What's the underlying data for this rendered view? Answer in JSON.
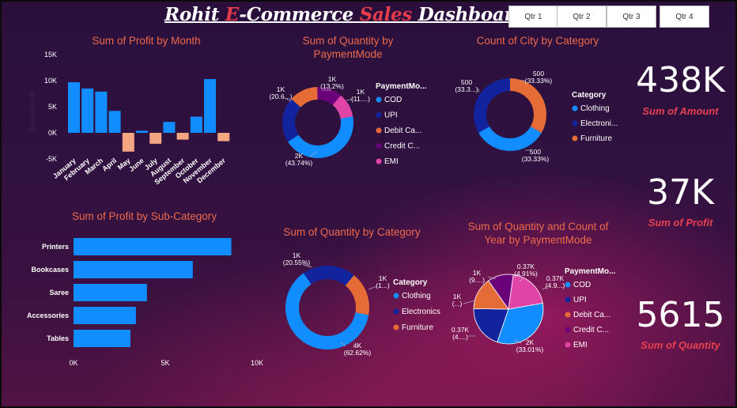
{
  "header": {
    "title_part1": "Rohit ",
    "title_part2": "E",
    "title_part3": "-Commerce ",
    "title_part4": "Sales",
    "title_part5": " Dashboard"
  },
  "slicer": [
    "Qtr 1",
    "Qtr 2",
    "Qtr 3",
    "Qtr 4"
  ],
  "colors": {
    "cod": "#118dff",
    "upi": "#12239e",
    "debit": "#e66c37",
    "credit": "#6b007b",
    "emi": "#e044a7",
    "profit_pos": "#118dff",
    "profit_neg": "#f4a582",
    "title": "#ee6a4a",
    "kpi_label": "#e84050"
  },
  "kpis": [
    {
      "value": "438K",
      "label": "Sum of Amount"
    },
    {
      "value": "37K",
      "label": "Sum of Profit"
    },
    {
      "value": "5615",
      "label": "Sum of Quantity"
    }
  ],
  "chart_data": [
    {
      "id": "profit_month",
      "type": "bar",
      "title": "Sum of Profit by Month",
      "ylabel": "Sum of Profit",
      "xlabel": "",
      "ylim": [
        -5000,
        15000
      ],
      "yticks": [
        "15K",
        "10K",
        "5K",
        "0K",
        "-5K"
      ],
      "categories": [
        "January",
        "February",
        "March",
        "April",
        "May",
        "June",
        "July",
        "August",
        "September",
        "October",
        "November",
        "December"
      ],
      "values": [
        9700,
        8500,
        7900,
        4200,
        -3600,
        400,
        -2100,
        2100,
        -1300,
        3100,
        10300,
        -1600
      ]
    },
    {
      "id": "qty_payment",
      "type": "pie",
      "donut": true,
      "title": "Sum of Quantity by PaymentMode",
      "legend_title": "PaymentMo...",
      "legend": [
        "COD",
        "UPI",
        "Debit Ca...",
        "Credit C...",
        "EMI"
      ],
      "series": [
        {
          "name": "COD",
          "value": 43.74,
          "label": "2K",
          "sublabel": "(43.74%)"
        },
        {
          "name": "UPI",
          "value": 20.6,
          "label": "1K",
          "sublabel": "(20.6...)"
        },
        {
          "name": "Debit Card",
          "value": 13.2,
          "label": "1K",
          "sublabel": "(13.2%)"
        },
        {
          "name": "Credit Card",
          "value": 11.4,
          "label": "1K",
          "sublabel": "(11....)"
        },
        {
          "name": "EMI",
          "value": 11.06,
          "label": "",
          "sublabel": ""
        }
      ]
    },
    {
      "id": "city_category",
      "type": "pie",
      "donut": true,
      "title": "Count of City by Category",
      "legend_title": "Category",
      "legend": [
        "Clothing",
        "Electroni...",
        "Furniture"
      ],
      "series": [
        {
          "name": "Clothing",
          "value": 33.33,
          "label": "500",
          "sublabel": "(33.33%)"
        },
        {
          "name": "Electronics",
          "value": 33.33,
          "label": "500",
          "sublabel": "(33.3...)"
        },
        {
          "name": "Furniture",
          "value": 33.33,
          "label": "500",
          "sublabel": "(33.33%)"
        }
      ]
    },
    {
      "id": "profit_subcat",
      "type": "bar",
      "orientation": "horizontal",
      "title": "Sum of Profit by Sub-Category",
      "xlim": [
        0,
        10000
      ],
      "xticks": [
        "0K",
        "5K",
        "10K"
      ],
      "categories": [
        "Printers",
        "Bookcases",
        "Saree",
        "Accessories",
        "Tables"
      ],
      "values": [
        8600,
        6500,
        4000,
        3400,
        3100
      ]
    },
    {
      "id": "qty_category",
      "type": "pie",
      "donut": true,
      "title": "Sum of Quantity by Category",
      "legend_title": "Category",
      "legend": [
        "Clothing",
        "Electronics",
        "Furniture"
      ],
      "series": [
        {
          "name": "Clothing",
          "value": 62.62,
          "label": "4K",
          "sublabel": "(62.62%)"
        },
        {
          "name": "Electronics",
          "value": 20.55,
          "label": "1K",
          "sublabel": "(20.55%)"
        },
        {
          "name": "Furniture",
          "value": 16.83,
          "label": "1K",
          "sublabel": "(1...)"
        }
      ]
    },
    {
      "id": "qty_year_payment",
      "type": "pie",
      "title": "Sum of Quantity and Count of Year by PaymentMode",
      "legend_title": "PaymentMo...",
      "legend": [
        "COD",
        "UPI",
        "Debit Ca...",
        "Credit C...",
        "EMI"
      ],
      "series": [
        {
          "name": "COD",
          "value": 33.01,
          "label": "2K",
          "sublabel": "(33.01%)"
        },
        {
          "name": "UPI",
          "value": 20.0,
          "label": "1K",
          "sublabel": "(...)"
        },
        {
          "name": "Debit Card",
          "value": 15.0,
          "label": "1K",
          "sublabel": "(9....)"
        },
        {
          "name": "Credit Card",
          "value": 12.0,
          "label": "0.37K",
          "sublabel": "(4.91%)"
        },
        {
          "name": "EMI",
          "value": 19.99,
          "label": "0.37K",
          "sublabel": "(4.9...)"
        }
      ],
      "extra_labels": [
        {
          "label": "0.37K",
          "sublabel": "(4....)"
        }
      ]
    }
  ]
}
